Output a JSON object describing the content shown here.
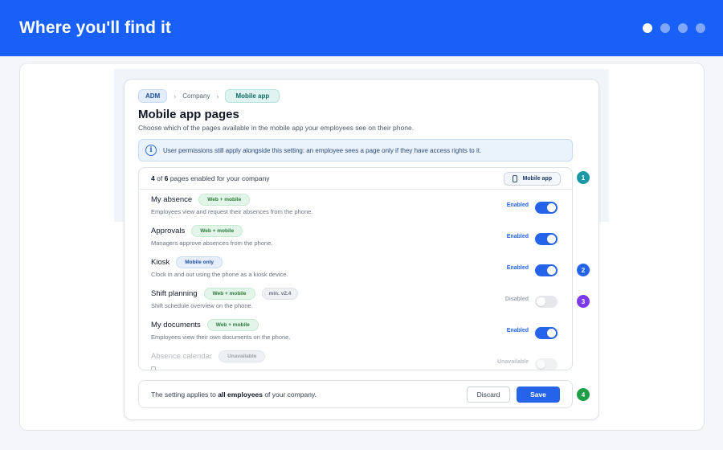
{
  "banner": {
    "title": "Where you'll find it",
    "steps": 4,
    "active_step": 1
  },
  "breadcrumb": {
    "root": "ADM",
    "middle": "Company",
    "current": "Mobile app",
    "separator": "›"
  },
  "page": {
    "title": "Mobile app pages",
    "subtitle": "Choose which of the pages available in the mobile app your employees see on their phone."
  },
  "info": {
    "icon": "info-circle-icon",
    "text": "User permissions still apply alongside this setting: an employee sees a page only if they have access rights to it."
  },
  "summary": {
    "enabled": "4",
    "total": "6",
    "of": "of",
    "suffix": "pages enabled for your company",
    "pill": "Mobile app",
    "pill_icon": "phone-icon"
  },
  "rows": [
    {
      "name": "My absence",
      "tag": "Web + mobile",
      "tag_kind": "web",
      "version": "",
      "desc": "Employees view and request their absences from the phone.",
      "status": "Enabled",
      "state": "on"
    },
    {
      "name": "Approvals",
      "tag": "Web + mobile",
      "tag_kind": "web",
      "version": "",
      "desc": "Managers approve absences from the phone.",
      "status": "Enabled",
      "state": "on"
    },
    {
      "name": "Kiosk",
      "tag": "Mobile only",
      "tag_kind": "mobonly",
      "version": "",
      "desc": "Clock in and out using the phone as a kiosk device.",
      "status": "Enabled",
      "state": "on"
    },
    {
      "name": "Shift planning",
      "tag": "Web + mobile",
      "tag_kind": "web",
      "version": "min. v2.4",
      "desc": "Shift schedule overview on the phone.",
      "status": "Disabled",
      "state": "off"
    },
    {
      "name": "My documents",
      "tag": "Web + mobile",
      "tag_kind": "web",
      "version": "",
      "desc": "Employees view their own documents on the phone.",
      "status": "Enabled",
      "state": "on"
    },
    {
      "name": "Absence calendar",
      "tag": "Unavailable",
      "tag_kind": "unav",
      "version": "",
      "desc": "",
      "status": "Unavailable",
      "state": "na"
    }
  ],
  "footer": {
    "prefix": "The setting applies to",
    "bold": "all employees",
    "suffix": "of your company.",
    "discard": "Discard",
    "save": "Save"
  },
  "badges": [
    {
      "label": "1",
      "color": "#1a98a6"
    },
    {
      "label": "2",
      "color": "#2563eb"
    },
    {
      "label": "3",
      "color": "#7c3aed"
    },
    {
      "label": "4",
      "color": "#1e9e46"
    }
  ]
}
